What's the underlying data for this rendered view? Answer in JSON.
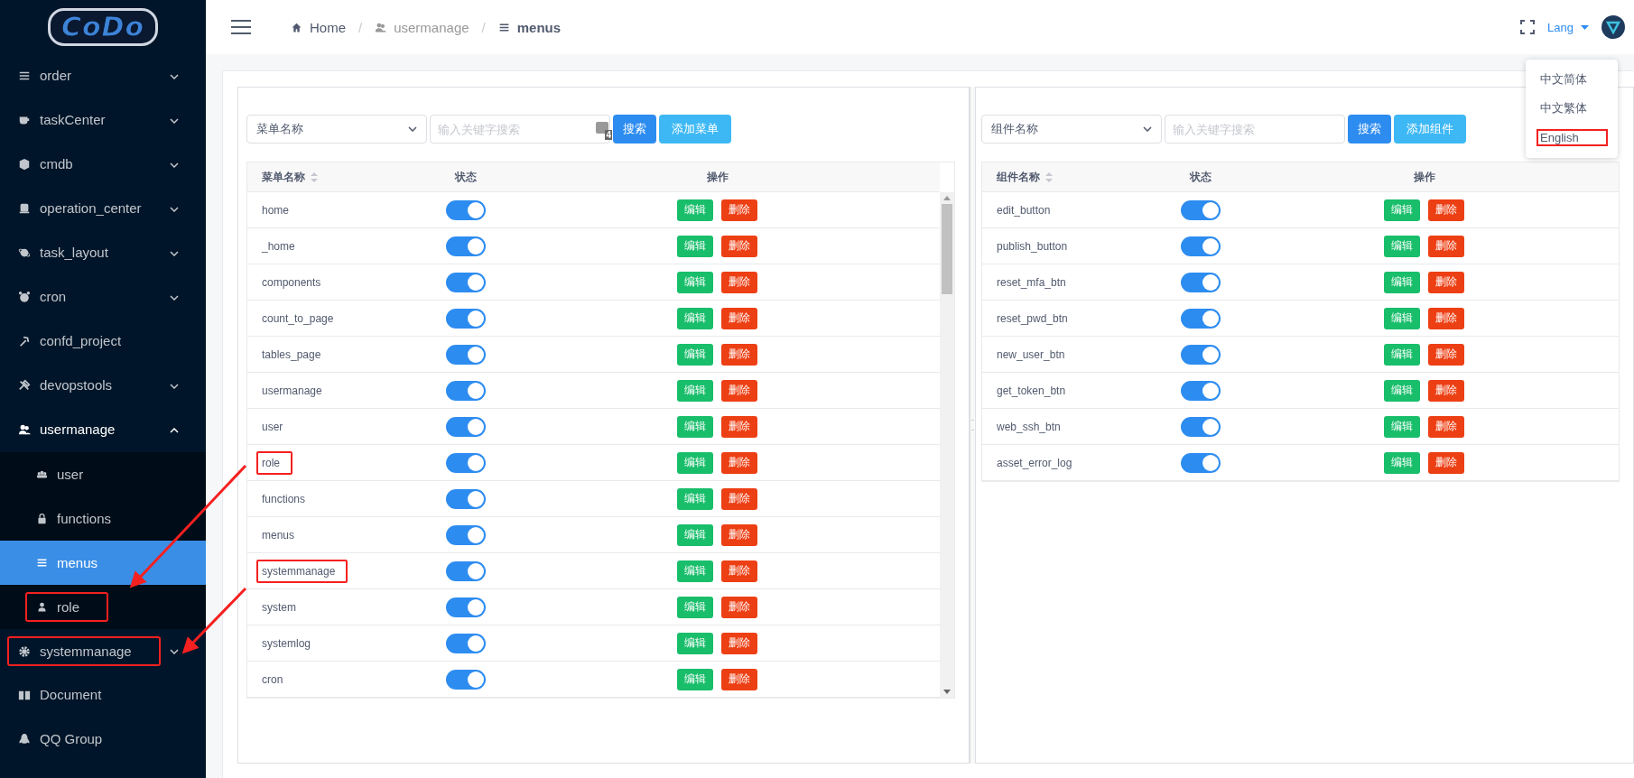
{
  "sidebar": {
    "logo": "CoDo",
    "items": [
      {
        "label": "order",
        "expandable": true,
        "expanded": false,
        "annotated": false
      },
      {
        "label": "taskCenter",
        "expandable": true,
        "expanded": false,
        "annotated": false
      },
      {
        "label": "cmdb",
        "expandable": true,
        "expanded": false,
        "annotated": false
      },
      {
        "label": "operation_center",
        "expandable": true,
        "expanded": false,
        "annotated": false
      },
      {
        "label": "task_layout",
        "expandable": true,
        "expanded": false,
        "annotated": false
      },
      {
        "label": "cron",
        "expandable": true,
        "expanded": false,
        "annotated": false
      },
      {
        "label": "confd_project",
        "expandable": false,
        "expanded": false,
        "annotated": false
      },
      {
        "label": "devopstools",
        "expandable": true,
        "expanded": false,
        "annotated": false
      },
      {
        "label": "usermanage",
        "expandable": true,
        "expanded": true,
        "annotated": false,
        "children": [
          {
            "label": "user",
            "selected": false,
            "annotated": false
          },
          {
            "label": "functions",
            "selected": false,
            "annotated": false
          },
          {
            "label": "menus",
            "selected": true,
            "annotated": false
          },
          {
            "label": "role",
            "selected": false,
            "annotated": true
          }
        ]
      },
      {
        "label": "systemmanage",
        "expandable": true,
        "expanded": false,
        "annotated": true
      },
      {
        "label": "Document",
        "expandable": false,
        "expanded": false,
        "annotated": false
      },
      {
        "label": "QQ Group",
        "expandable": false,
        "expanded": false,
        "annotated": false
      }
    ]
  },
  "header": {
    "breadcrumb": [
      {
        "label": "Home"
      },
      {
        "separator": "/",
        "label": "usermanage"
      },
      {
        "separator": "/",
        "label": "menus"
      }
    ],
    "lang_label": "Lang",
    "lang_menu": [
      {
        "label": "中文简体",
        "annotated": false
      },
      {
        "label": "中文繁体",
        "annotated": false
      },
      {
        "label": "English",
        "annotated": true
      }
    ]
  },
  "panels": [
    {
      "filter_select": "菜单名称",
      "search": {
        "placeholder": "输入关键字搜索",
        "extension_badge": "4"
      },
      "search_button": "搜索",
      "add_button": "添加菜单",
      "columns": [
        "菜单名称",
        "状态",
        "操作"
      ],
      "rows": [
        {
          "name": "home",
          "enabled": true,
          "annotated": false,
          "edit": "编辑",
          "delete": "删除"
        },
        {
          "name": "_home",
          "enabled": true,
          "annotated": false,
          "edit": "编辑",
          "delete": "删除"
        },
        {
          "name": "components",
          "enabled": true,
          "annotated": false,
          "edit": "编辑",
          "delete": "删除"
        },
        {
          "name": "count_to_page",
          "enabled": true,
          "annotated": false,
          "edit": "编辑",
          "delete": "删除"
        },
        {
          "name": "tables_page",
          "enabled": true,
          "annotated": false,
          "edit": "编辑",
          "delete": "删除"
        },
        {
          "name": "usermanage",
          "enabled": true,
          "annotated": false,
          "edit": "编辑",
          "delete": "删除"
        },
        {
          "name": "user",
          "enabled": true,
          "annotated": false,
          "edit": "编辑",
          "delete": "删除"
        },
        {
          "name": "role",
          "enabled": true,
          "annotated": true,
          "edit": "编辑",
          "delete": "删除"
        },
        {
          "name": "functions",
          "enabled": true,
          "annotated": false,
          "edit": "编辑",
          "delete": "删除"
        },
        {
          "name": "menus",
          "enabled": true,
          "annotated": false,
          "edit": "编辑",
          "delete": "删除"
        },
        {
          "name": "systemmanage",
          "enabled": true,
          "annotated": true,
          "edit": "编辑",
          "delete": "删除"
        },
        {
          "name": "system",
          "enabled": true,
          "annotated": false,
          "edit": "编辑",
          "delete": "删除"
        },
        {
          "name": "systemlog",
          "enabled": true,
          "annotated": false,
          "edit": "编辑",
          "delete": "删除"
        },
        {
          "name": "cron",
          "enabled": true,
          "annotated": false,
          "edit": "编辑",
          "delete": "删除"
        }
      ]
    },
    {
      "filter_select": "组件名称",
      "search": {
        "placeholder": "输入关键字搜索"
      },
      "search_button": "搜索",
      "add_button": "添加组件",
      "columns": [
        "组件名称",
        "状态",
        "操作"
      ],
      "rows": [
        {
          "name": "edit_button",
          "enabled": true,
          "annotated": false,
          "edit": "编辑",
          "delete": "删除"
        },
        {
          "name": "publish_button",
          "enabled": true,
          "annotated": false,
          "edit": "编辑",
          "delete": "删除"
        },
        {
          "name": "reset_mfa_btn",
          "enabled": true,
          "annotated": false,
          "edit": "编辑",
          "delete": "删除"
        },
        {
          "name": "reset_pwd_btn",
          "enabled": true,
          "annotated": false,
          "edit": "编辑",
          "delete": "删除"
        },
        {
          "name": "new_user_btn",
          "enabled": true,
          "annotated": false,
          "edit": "编辑",
          "delete": "删除"
        },
        {
          "name": "get_token_btn",
          "enabled": true,
          "annotated": false,
          "edit": "编辑",
          "delete": "删除"
        },
        {
          "name": "web_ssh_btn",
          "enabled": true,
          "annotated": false,
          "edit": "编辑",
          "delete": "删除"
        },
        {
          "name": "asset_error_log",
          "enabled": true,
          "annotated": false,
          "edit": "编辑",
          "delete": "删除"
        }
      ]
    }
  ]
}
